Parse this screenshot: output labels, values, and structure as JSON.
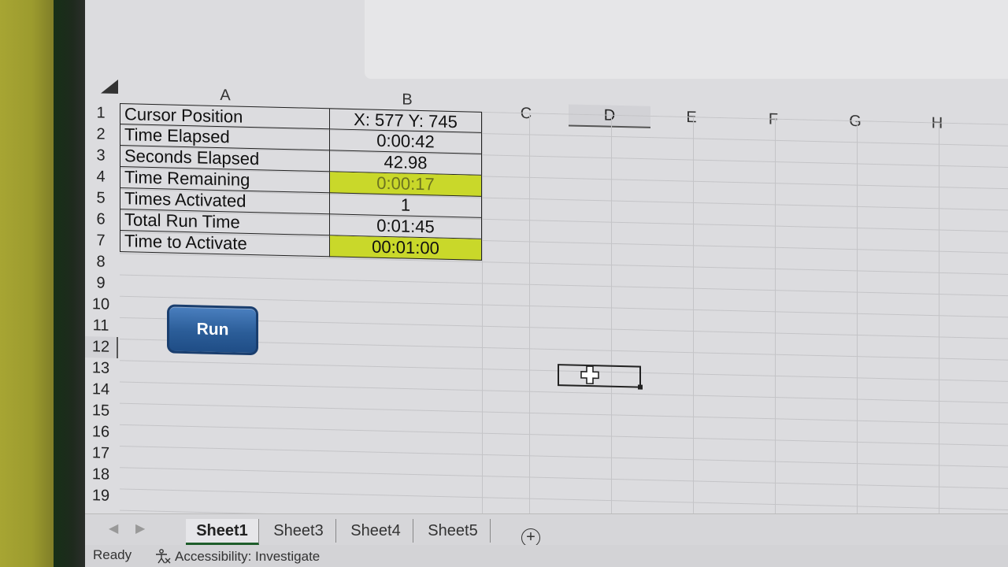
{
  "grid": {
    "columns": [
      "A",
      "B",
      "C",
      "D",
      "E",
      "F",
      "G",
      "H"
    ],
    "selected_column": "D",
    "rows": [
      "1",
      "2",
      "3",
      "4",
      "5",
      "6",
      "7",
      "8",
      "9",
      "10",
      "11",
      "12",
      "13",
      "14",
      "15",
      "16",
      "17",
      "18",
      "19"
    ],
    "selected_row": "12"
  },
  "table": [
    {
      "label": "Cursor Position",
      "value": "X: 577 Y: 745",
      "highlight": false
    },
    {
      "label": "Time Elapsed",
      "value": "0:00:42",
      "highlight": false
    },
    {
      "label": "Seconds Elapsed",
      "value": "42.98",
      "highlight": false
    },
    {
      "label": "Time Remaining",
      "value": "0:00:17",
      "highlight": true
    },
    {
      "label": "Times Activated",
      "value": "1",
      "highlight": false
    },
    {
      "label": "Total Run Time",
      "value": "0:01:45",
      "highlight": false
    },
    {
      "label": "Time to Activate",
      "value": "00:01:00",
      "highlight": true
    }
  ],
  "run_button": {
    "label": "Run"
  },
  "sheet_tabs": [
    "Sheet1",
    "Sheet3",
    "Sheet4",
    "Sheet5"
  ],
  "active_sheet": "Sheet1",
  "add_sheet_glyph": "+",
  "status": {
    "ready": "Ready",
    "accessibility": "Accessibility: Investigate"
  },
  "colors": {
    "highlight": "#c9d82a",
    "button": "#2b5d98"
  }
}
